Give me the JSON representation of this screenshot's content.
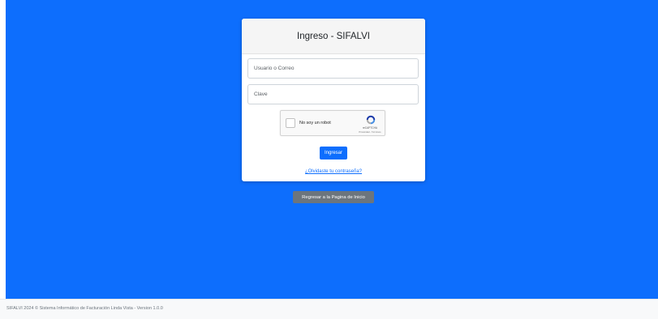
{
  "login": {
    "title": "Ingreso - SIFALVI",
    "user_placeholder": "Usuario o Correo",
    "password_placeholder": "Clave",
    "submit_label": "Ingresar",
    "forgot_label": "¿Olvidaste tu contraseña?"
  },
  "recaptcha": {
    "label": "No soy un robot",
    "brand": "reCAPTCHA",
    "terms": "Privacidad - Términos"
  },
  "back_button_label": "Regresar a la Pagina de Inicio",
  "footer": {
    "text": "SIFALVI 2024 © Sistema Informático de Facturación Linda Vista - Version 1.0.0"
  },
  "colors": {
    "background_blue": "#0d6efd",
    "primary_button": "#0d6efd",
    "secondary_button": "#6c757d"
  }
}
